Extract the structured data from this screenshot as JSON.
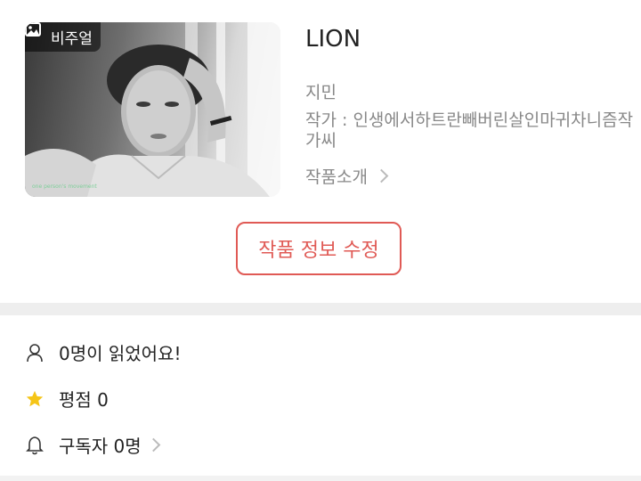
{
  "work": {
    "badge": "비주얼",
    "badge_icon": "image-icon",
    "title": "LION",
    "author": "지민",
    "writer": "작가 : 인생에서하트란빼버린살인마귀차니즘작가씨",
    "intro_label": "작품소개",
    "cover_caption": "one person's movement"
  },
  "actions": {
    "edit_label": "작품 정보 수정"
  },
  "stats": {
    "readers": "0명이 읽었어요!",
    "rating": "평점 0",
    "subscribers": "구독자 0명"
  },
  "colors": {
    "accent": "#e05a55",
    "star": "#f5c518",
    "muted_text": "#888888",
    "divider": "#eeeeee"
  }
}
